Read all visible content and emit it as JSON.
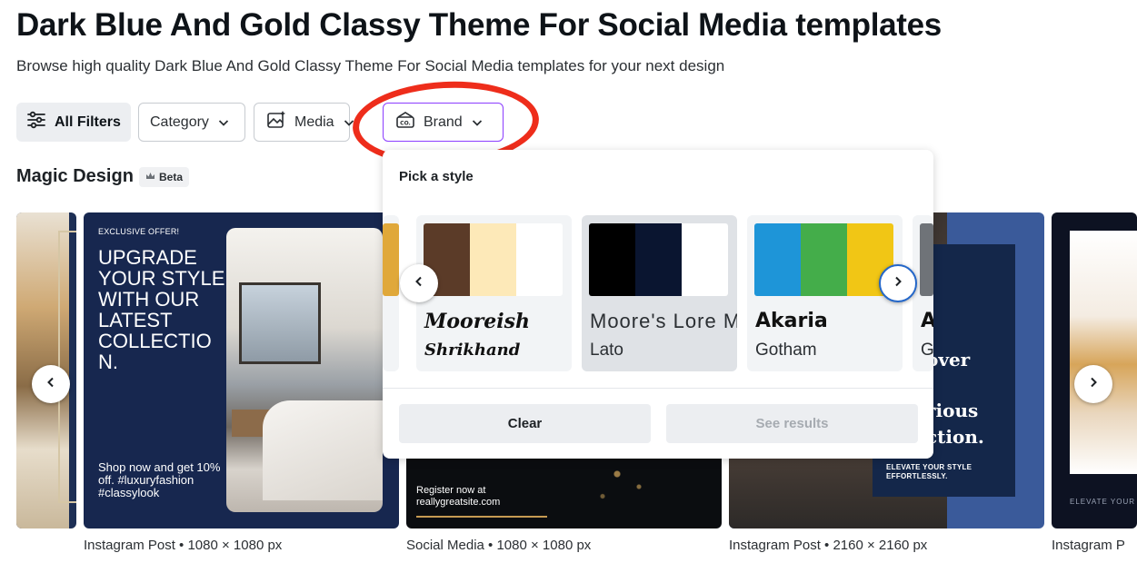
{
  "header": {
    "title": "Dark Blue And Gold Classy Theme For Social Media templates",
    "subtitle": "Browse high quality Dark Blue And Gold Classy Theme For Social Media templates for your next design"
  },
  "filters": {
    "all_filters": "All Filters",
    "category": "Category",
    "media": "Media",
    "brand": "Brand"
  },
  "section": {
    "title": "Magic Design",
    "badge": "Beta"
  },
  "brand_popover": {
    "title": "Pick a style",
    "styles": [
      {
        "font_primary": "",
        "font_secondary": "",
        "colors": [
          "#e0a83a"
        ]
      },
      {
        "font_primary": "Mooreish",
        "font_secondary": "Shrikhand",
        "colors": [
          "#5b3b28",
          "#fde9b8",
          "#ffffff"
        ]
      },
      {
        "font_primary": "Moore's Lore M",
        "font_secondary": "Lato",
        "colors": [
          "#000000",
          "#0a1530",
          "#ffffff"
        ],
        "selected": true
      },
      {
        "font_primary": "Akaria",
        "font_secondary": "Gotham",
        "colors": [
          "#1e95d8",
          "#44ad4a",
          "#f1c615"
        ]
      },
      {
        "font_primary": "A",
        "font_secondary": "G",
        "colors": [
          "#6f7378"
        ]
      }
    ],
    "clear_label": "Clear",
    "see_results_label": "See results"
  },
  "templates": [
    {
      "caption": ""
    },
    {
      "caption": "Instagram Post • 1080 × 1080 px",
      "eyebrow": "EXCLUSIVE OFFER!",
      "headline": "UPGRADE YOUR STYLE WITH OUR LATEST COLLECTIO N.",
      "footer": "Shop now and get 10% off. #luxuryfashion #classylook"
    },
    {
      "caption": "Social Media • 1080 × 1080 px",
      "register": "Register now at reallygreatsite.com"
    },
    {
      "caption": "Instagram Post • 2160 × 2160 px",
      "line1": "over",
      "line2": "rious",
      "line3": "ction.",
      "tagline": "ELEVATE YOUR STYLE EFFORTLESSLY."
    },
    {
      "caption": "Instagram P",
      "tagline": "ELEVATE YOUR"
    }
  ],
  "colors": {
    "accent": "#8b3dff",
    "highlight": "#ee2d1b",
    "focus": "#2467c9"
  }
}
